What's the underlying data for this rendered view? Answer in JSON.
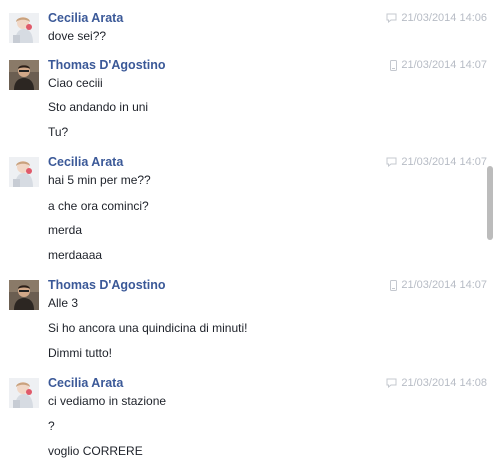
{
  "conversation": {
    "groups": [
      {
        "sender": "Cecilia Arata",
        "avatar": "cecilia-avatar",
        "device_icon": "chat-icon",
        "timestamp": "21/03/2014 14:06",
        "messages": [
          "dove sei??"
        ]
      },
      {
        "sender": "Thomas D'Agostino",
        "avatar": "thomas-avatar",
        "device_icon": "mobile-icon",
        "timestamp": "21/03/2014 14:07",
        "messages": [
          "Ciao ceciii",
          "Sto andando in uni",
          "Tu?"
        ]
      },
      {
        "sender": "Cecilia Arata",
        "avatar": "cecilia-avatar",
        "device_icon": "chat-icon",
        "timestamp": "21/03/2014 14:07",
        "messages": [
          "hai 5 min per me??",
          "a che ora cominci?",
          "merda",
          "merdaaaa"
        ]
      },
      {
        "sender": "Thomas D'Agostino",
        "avatar": "thomas-avatar",
        "device_icon": "mobile-icon",
        "timestamp": "21/03/2014 14:07",
        "messages": [
          "Alle 3",
          "Si ho ancora una quindicina di minuti!",
          "Dimmi tutto!"
        ]
      },
      {
        "sender": "Cecilia Arata",
        "avatar": "cecilia-avatar",
        "device_icon": "chat-icon",
        "timestamp": "21/03/2014 14:08",
        "messages": [
          "ci vediamo in stazione",
          "?",
          "voglio CORRERE"
        ]
      }
    ]
  },
  "colors": {
    "sender_name": "#3b5998",
    "message_text": "#1d2129",
    "meta_text": "#b7bcc5",
    "scrollbar_thumb": "#bcbcbc"
  }
}
